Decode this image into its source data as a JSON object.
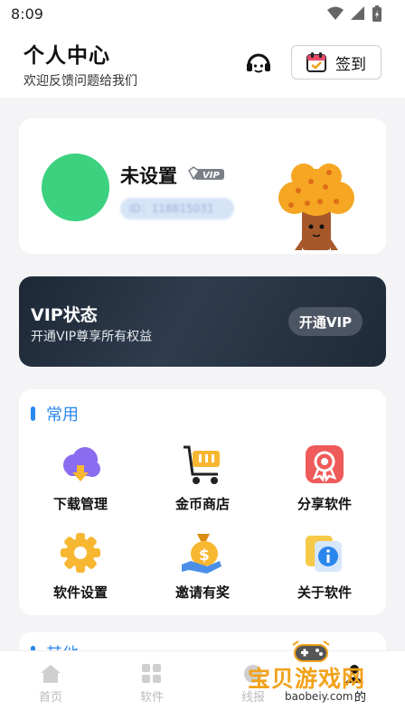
{
  "status": {
    "time": "8:09"
  },
  "header": {
    "title": "个人中心",
    "subtitle": "欢迎反馈问题给我们",
    "signin_label": "签到"
  },
  "profile": {
    "username": "未设置",
    "vip_badge": "VIP",
    "uid_text": "ID：118815031"
  },
  "vip_card": {
    "title": "VIP状态",
    "description": "开通VIP尊享所有权益",
    "button_label": "开通VIP"
  },
  "common": {
    "title": "常用",
    "items": [
      {
        "label": "下载管理",
        "icon": "cloud-download-icon"
      },
      {
        "label": "金币商店",
        "icon": "shopping-cart-icon"
      },
      {
        "label": "分享软件",
        "icon": "award-badge-icon"
      },
      {
        "label": "软件设置",
        "icon": "gear-icon"
      },
      {
        "label": "邀请有奖",
        "icon": "money-bag-icon"
      },
      {
        "label": "关于软件",
        "icon": "info-icon"
      }
    ]
  },
  "other": {
    "title": "其他"
  },
  "tabs": [
    {
      "label": "首页",
      "icon": "home-icon"
    },
    {
      "label": "软件",
      "icon": "apps-grid-icon"
    },
    {
      "label": "线报",
      "icon": "news-icon"
    },
    {
      "label": "我的",
      "icon": "user-icon"
    }
  ],
  "watermark": {
    "brand": "宝贝游戏网",
    "url": "baobeiy.com"
  },
  "colors": {
    "accent": "#2a87ee",
    "avatar": "#3bd17f",
    "vip_bg": "#1f2a38"
  }
}
